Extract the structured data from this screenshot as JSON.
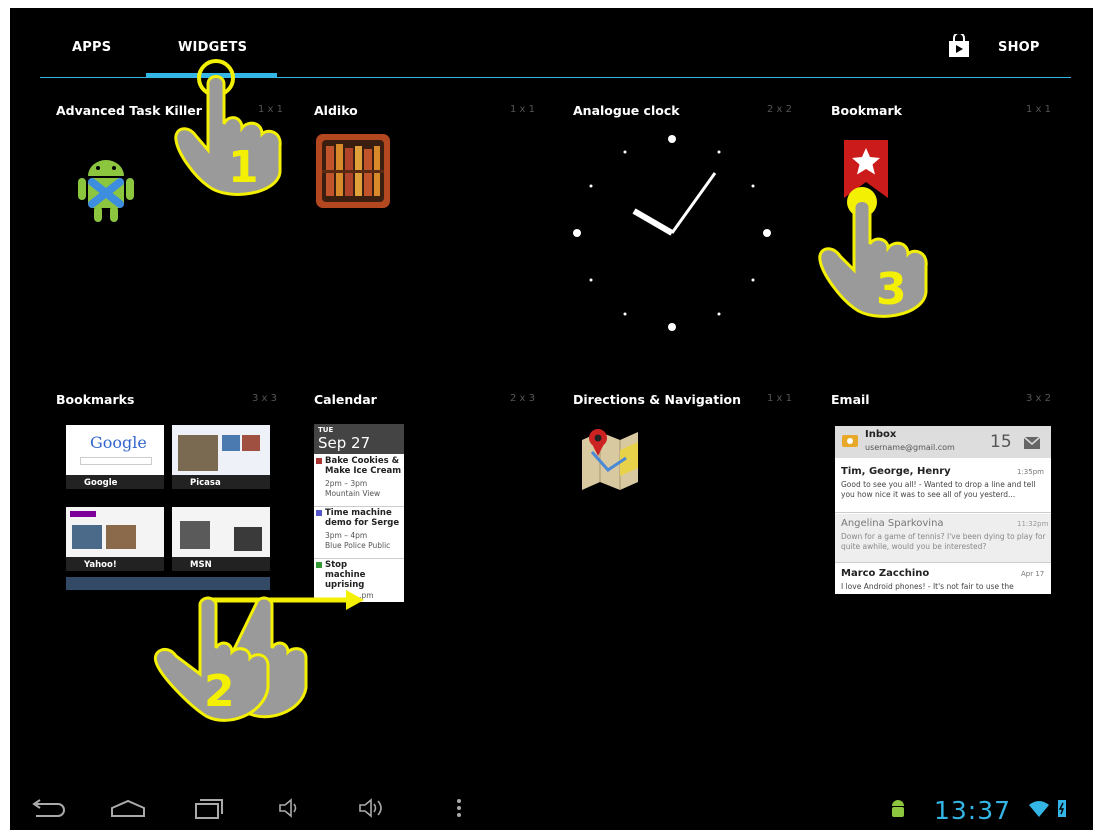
{
  "tabs": {
    "apps": "APPS",
    "widgets": "WIDGETS",
    "shop": "SHOP"
  },
  "widgets": [
    {
      "title": "Advanced Task Killer Fr",
      "size": "1 x 1"
    },
    {
      "title": "Aldiko",
      "size": "1 x 1"
    },
    {
      "title": "Analogue clock",
      "size": "2 x 2"
    },
    {
      "title": "Bookmark",
      "size": "1 x 1"
    },
    {
      "title": "Bookmarks",
      "size": "3 x 3"
    },
    {
      "title": "Calendar",
      "size": "2 x 3"
    },
    {
      "title": "Directions & Navigation",
      "size": "1 x 1"
    },
    {
      "title": "Email",
      "size": "3 x 2"
    }
  ],
  "bookmarks_preview": [
    {
      "label": "Google"
    },
    {
      "label": "Picasa"
    },
    {
      "label": "Yahoo!"
    },
    {
      "label": "MSN"
    }
  ],
  "google_logo": "Google",
  "calendar_preview": {
    "day": "TUE",
    "date": "Sep 27",
    "events": [
      {
        "title": "Bake Cookies & Make Ice Cream",
        "time": "2pm – 3pm",
        "place": "Mountain View",
        "color": "#a33"
      },
      {
        "title": "Time machine demo for Serge",
        "time": "3pm – 4pm",
        "place": "Blue Police Public",
        "color": "#55c"
      },
      {
        "title": "Stop machine uprising",
        "time": "…pm",
        "place": "",
        "color": "#393"
      }
    ]
  },
  "email_preview": {
    "header": "Inbox",
    "account": "username@gmail.com",
    "count": "15",
    "messages": [
      {
        "from": "Tim, George, Henry",
        "time": "1:35pm",
        "body": "Good to see you all! - Wanted to drop a line and tell you how nice it was to see all of you yesterd..."
      },
      {
        "from": "Angelina Sparkovina",
        "time": "11:32pm",
        "body": "Down for a game of tennis? I've been dying to play for quite awhile, would you be interested?"
      },
      {
        "from": "Marco Zacchino",
        "time": "Apr 17",
        "body": "I love Android phones! - It's not fair to use the"
      }
    ]
  },
  "steps": [
    "1",
    "2",
    "3"
  ],
  "status": {
    "time": "13:37"
  },
  "colors": {
    "accent": "#33b5e5",
    "hand": "#9a9a9a",
    "hand_outline": "#f4f004",
    "clock_time": "#33b5e5"
  }
}
